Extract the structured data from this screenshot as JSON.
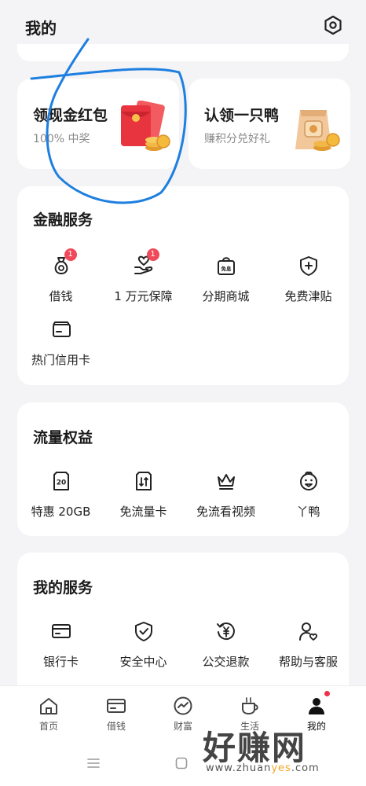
{
  "header": {
    "title": "我的",
    "settings_icon": "settings-hexagon-icon"
  },
  "promos": [
    {
      "title": "领现金红包",
      "subtitle": "100% 中奖",
      "image": "red-envelope-coins"
    },
    {
      "title": "认领一只鸭",
      "subtitle": "赚积分兑好礼",
      "image": "gift-bag-coins"
    }
  ],
  "finance": {
    "title": "金融服务",
    "items": [
      {
        "label": "借钱",
        "icon": "money-bag-icon",
        "badge": "1"
      },
      {
        "label": "1 万元保障",
        "icon": "hand-heart-icon",
        "badge": "1"
      },
      {
        "label": "分期商城",
        "icon": "shopping-bag-icon",
        "badge_text": "免息"
      },
      {
        "label": "免费津贴",
        "icon": "shield-plus-icon"
      },
      {
        "label": "热门信用卡",
        "icon": "credit-card-icon"
      }
    ]
  },
  "traffic": {
    "title": "流量权益",
    "items": [
      {
        "label": "特惠 20GB",
        "icon": "sim-20-icon",
        "icon_text": "20"
      },
      {
        "label": "免流量卡",
        "icon": "sim-card-icon"
      },
      {
        "label": "免流看视频",
        "icon": "crown-icon"
      },
      {
        "label": "丫鸭",
        "icon": "duck-icon"
      }
    ]
  },
  "services": {
    "title": "我的服务",
    "items": [
      {
        "label": "银行卡",
        "icon": "bank-card-icon"
      },
      {
        "label": "安全中心",
        "icon": "shield-check-icon"
      },
      {
        "label": "公交退款",
        "icon": "yuan-refund-icon"
      },
      {
        "label": "帮助与客服",
        "icon": "person-heart-icon"
      }
    ]
  },
  "tabbar": [
    {
      "label": "首页",
      "icon": "home-icon"
    },
    {
      "label": "借钱",
      "icon": "wallet-card-icon"
    },
    {
      "label": "财富",
      "icon": "trend-circle-icon"
    },
    {
      "label": "生活",
      "icon": "coffee-cup-icon"
    },
    {
      "label": "我的",
      "icon": "person-icon",
      "active": true,
      "dot": true
    }
  ],
  "watermark": {
    "text": "好赚网",
    "url_prefix": "www.zhuan",
    "url_highlight": "yes",
    "url_suffix": ".com"
  },
  "colors": {
    "accent": "#f04a5a",
    "scribble": "#1e7fe0",
    "background": "#f4f4f6"
  }
}
